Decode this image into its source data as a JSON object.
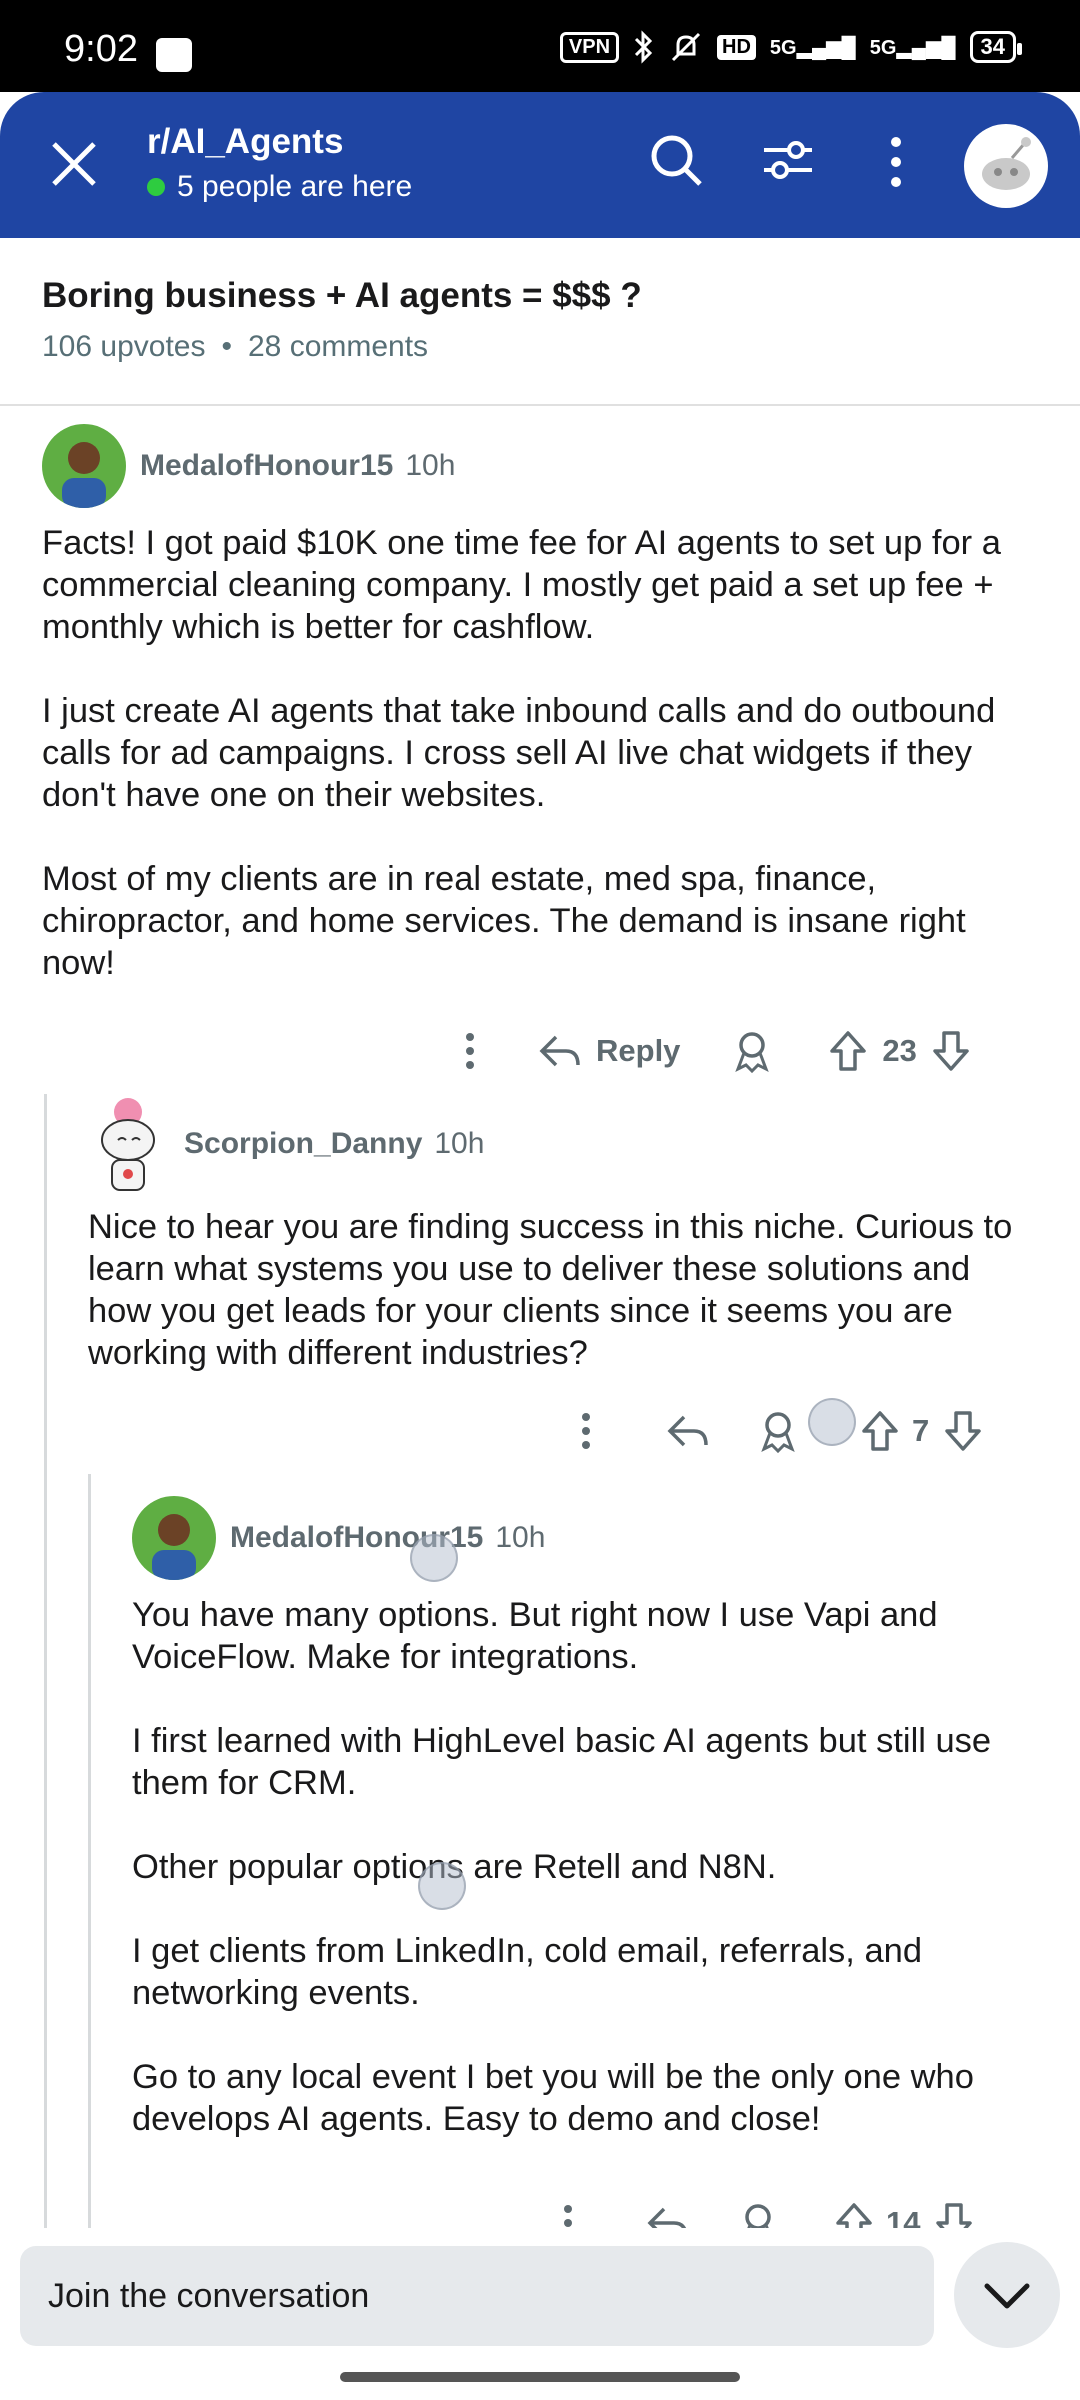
{
  "status_bar": {
    "time": "9:02",
    "vpn": "VPN",
    "hd": "HD",
    "network": "5G",
    "battery": "34"
  },
  "header": {
    "subreddit": "r/AI_Agents",
    "presence": "5 people are here",
    "accent": "#1f45a3"
  },
  "post": {
    "title": "Boring business + AI agents = $$$ ?",
    "upvotes": "106 upvotes",
    "separator": "•",
    "comments": "28 comments"
  },
  "comments": [
    {
      "author": "MedalofHonour15",
      "age": "10h",
      "paragraphs": [
        "Facts! I got paid $10K one time fee for AI agents to set up for a commercial cleaning company. I mostly get paid a set up fee + monthly which is better for cashflow.",
        "I just create AI agents that take inbound calls and do outbound calls for ad campaigns. I cross sell AI live chat widgets if they don't have one on their websites.",
        "Most of my clients are in real estate, med spa, finance, chiropractor, and home services. The demand is insane right now!"
      ],
      "reply_label": "Reply",
      "score": "23"
    },
    {
      "author": "Scorpion_Danny",
      "age": "10h",
      "paragraphs": [
        "Nice to hear you are finding success in this niche. Curious to learn what systems you use to deliver these solutions and how you get leads for your clients since it seems you are working with different industries?"
      ],
      "score": "7"
    },
    {
      "author": "MedalofHonour15",
      "age": "10h",
      "paragraphs": [
        "You have many options. But right now I use Vapi and VoiceFlow. Make for integrations.",
        "I first learned with HighLevel basic AI agents but still use them for CRM.",
        "Other popular options are Retell and N8N.",
        "I get clients from LinkedIn, cold email, referrals, and networking events.",
        "Go to any local event I bet you will be the only one who develops AI agents. Easy to demo and close!"
      ],
      "score": "14"
    }
  ],
  "composer": {
    "placeholder": "Join the conversation"
  }
}
